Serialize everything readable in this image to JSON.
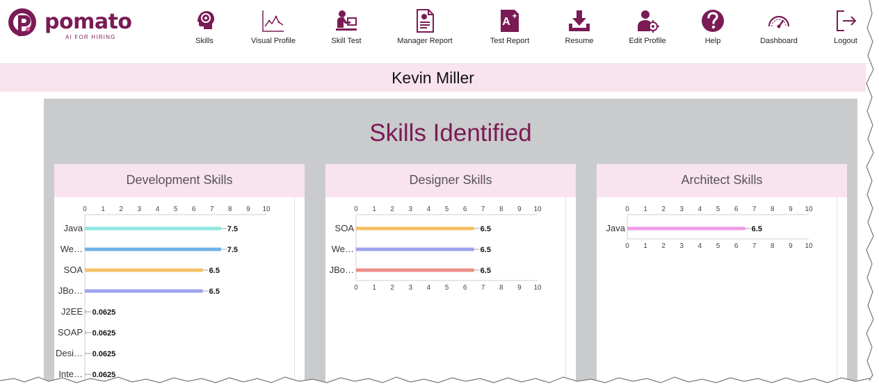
{
  "header": {
    "logo": {
      "name": "pomato",
      "tagline": "AI FOR HIRING"
    },
    "nav": [
      {
        "label": "Skills",
        "icon": "head-gear-icon"
      },
      {
        "label": "Visual Profile",
        "icon": "line-chart-icon"
      },
      {
        "label": "Skill Test",
        "icon": "person-laptop-icon"
      },
      {
        "label": "Manager Report",
        "icon": "document-icon"
      },
      {
        "label": "Test Report",
        "icon": "a-plus-icon"
      },
      {
        "label": "Resume",
        "icon": "download-icon"
      },
      {
        "label": "Edit Profile",
        "icon": "user-gear-icon"
      },
      {
        "label": "Help",
        "icon": "question-icon"
      },
      {
        "label": "Dashboard",
        "icon": "gauge-icon"
      },
      {
        "label": "Logout",
        "icon": "logout-icon"
      }
    ]
  },
  "candidate": {
    "name": "Kevin Miller"
  },
  "main": {
    "title": "Skills Identified",
    "cards": [
      {
        "title": "Development Skills"
      },
      {
        "title": "Designer Skills"
      },
      {
        "title": "Architect Skills"
      }
    ]
  },
  "colors": {
    "brand": "#7a1b55",
    "pink_band": "#f9e3ef",
    "panel_gray": "#cacbcd"
  },
  "chart_data": [
    {
      "type": "bar",
      "orientation": "horizontal",
      "categories": [
        "Java",
        "We…",
        "SOA",
        "JBo…",
        "J2EE",
        "SOAP",
        "Desi…",
        "Inte…"
      ],
      "values": [
        7.5,
        7.5,
        6.5,
        6.5,
        0.0625,
        0.0625,
        0.0625,
        0.0625
      ],
      "data_labels": [
        "7.5",
        "7.5",
        "6.5",
        "6.5",
        "0.0625",
        "0.0625",
        "0.0625",
        "0.0625"
      ],
      "bar_colors": [
        "#8ee6e0",
        "#6fb0e6",
        "#f4c066",
        "#9ea3ec",
        "#c9a7d6",
        "#c9a7d6",
        "#e8d56a",
        "#8ee6e0"
      ],
      "xlim": [
        0,
        10
      ],
      "xticks": [
        "0",
        "1",
        "2",
        "3",
        "4",
        "5",
        "6",
        "7",
        "8",
        "9",
        "10"
      ],
      "axis_top": true,
      "axis_bottom": false
    },
    {
      "type": "bar",
      "orientation": "horizontal",
      "categories": [
        "SOA",
        "We…",
        "JBo…"
      ],
      "values": [
        6.5,
        6.5,
        6.5
      ],
      "data_labels": [
        "6.5",
        "6.5",
        "6.5"
      ],
      "bar_colors": [
        "#f4c066",
        "#9ea3ec",
        "#ee8d86"
      ],
      "xlim": [
        0,
        10
      ],
      "xticks": [
        "0",
        "1",
        "2",
        "3",
        "4",
        "5",
        "6",
        "7",
        "8",
        "9",
        "10"
      ],
      "axis_top": true,
      "axis_bottom": true
    },
    {
      "type": "bar",
      "orientation": "horizontal",
      "categories": [
        "Java"
      ],
      "values": [
        6.5
      ],
      "data_labels": [
        "6.5"
      ],
      "bar_colors": [
        "#ef9ee8"
      ],
      "xlim": [
        0,
        10
      ],
      "xticks": [
        "0",
        "1",
        "2",
        "3",
        "4",
        "5",
        "6",
        "7",
        "8",
        "9",
        "10"
      ],
      "axis_top": true,
      "axis_bottom": true
    }
  ]
}
